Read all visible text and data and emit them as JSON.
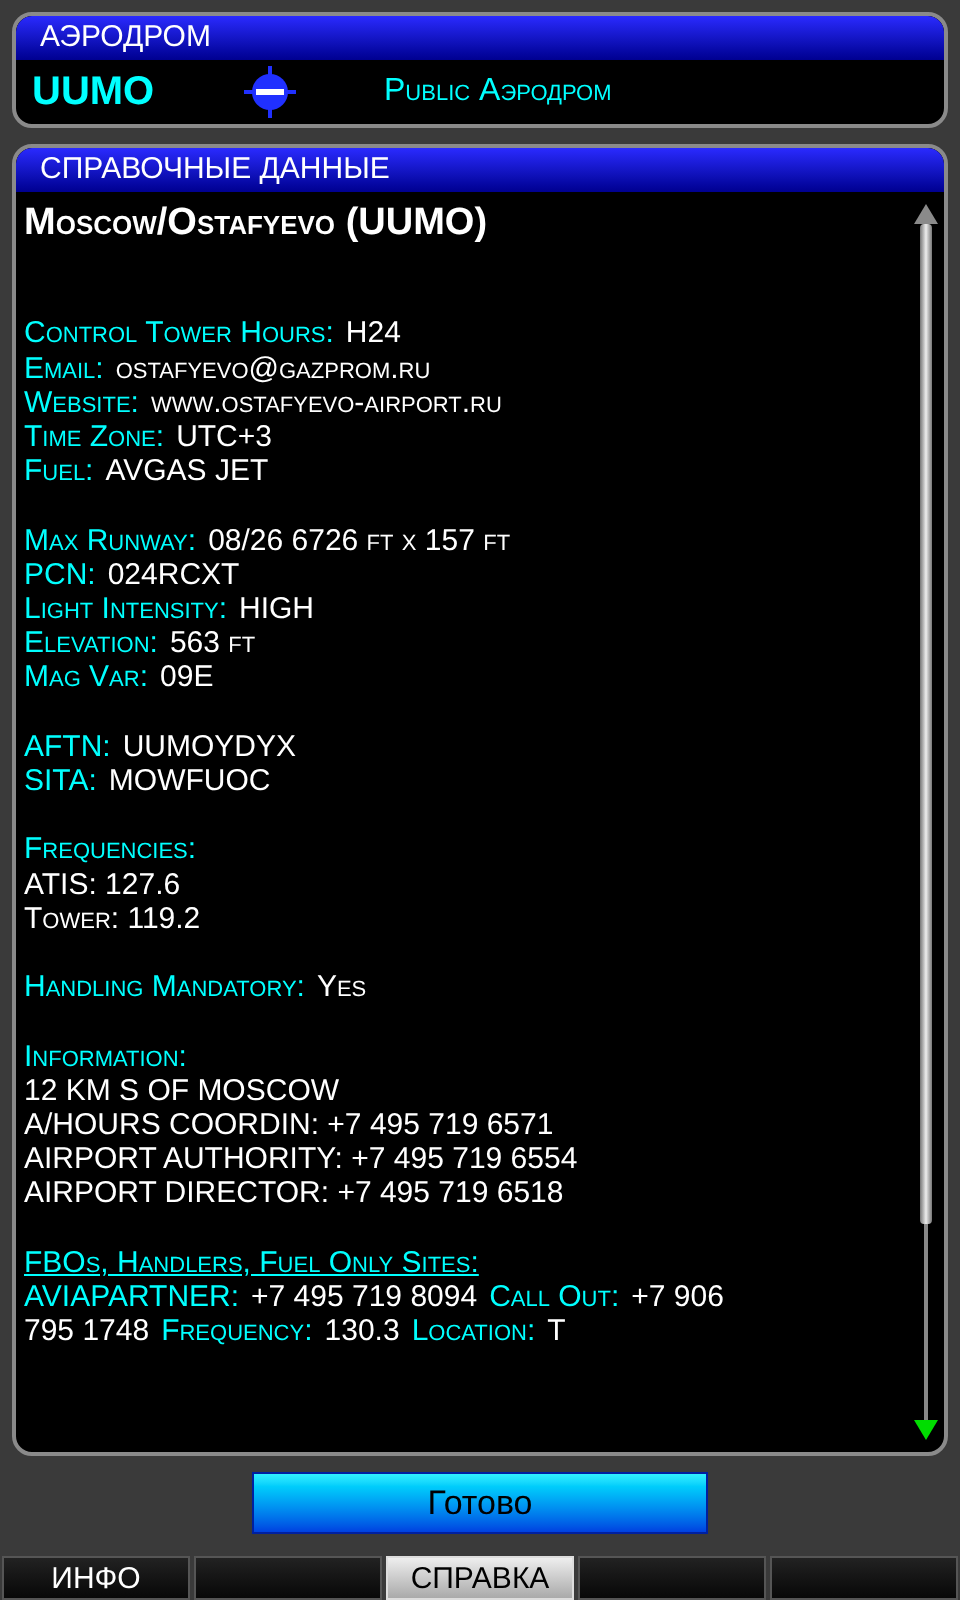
{
  "airport_panel": {
    "title": "АЭРОДРОМ",
    "ident": "UUMO",
    "type": "Public Аэродром"
  },
  "info_panel": {
    "title": "СПРАВОЧНЫЕ ДАННЫЕ",
    "heading": "Moscow/Ostafyevo (UUMO)",
    "lines": [
      {
        "kind": "blank"
      },
      {
        "kind": "blank"
      },
      {
        "kind": "text",
        "parts": [
          {
            "kind": "label",
            "text": "Control Tower Hours:"
          },
          {
            "kind": "value",
            "text": "H24"
          }
        ]
      },
      {
        "kind": "text",
        "parts": [
          {
            "kind": "label",
            "text": "Email:"
          },
          {
            "kind": "value",
            "text": "ostafyevo@gazprom.ru"
          }
        ]
      },
      {
        "kind": "text",
        "parts": [
          {
            "kind": "label",
            "text": "Website:"
          },
          {
            "kind": "value",
            "text": "www.ostafyevo-airport.ru"
          }
        ]
      },
      {
        "kind": "text",
        "parts": [
          {
            "kind": "label",
            "text": "Time Zone:"
          },
          {
            "kind": "value",
            "text": "UTC+3"
          }
        ]
      },
      {
        "kind": "text",
        "parts": [
          {
            "kind": "label",
            "text": "Fuel:"
          },
          {
            "kind": "value",
            "text": "AVGAS JET"
          }
        ]
      },
      {
        "kind": "blank"
      },
      {
        "kind": "text",
        "parts": [
          {
            "kind": "label",
            "text": "Max Runway:"
          },
          {
            "kind": "value",
            "text": "08/26 6726 ft x 157 ft"
          }
        ]
      },
      {
        "kind": "text",
        "parts": [
          {
            "kind": "label",
            "text": "PCN:"
          },
          {
            "kind": "value",
            "text": "024RCXT"
          }
        ]
      },
      {
        "kind": "text",
        "parts": [
          {
            "kind": "label",
            "text": "Light Intensity:"
          },
          {
            "kind": "value",
            "text": "HIGH"
          }
        ]
      },
      {
        "kind": "text",
        "parts": [
          {
            "kind": "label",
            "text": "Elevation:"
          },
          {
            "kind": "value",
            "text": "563 ft"
          }
        ]
      },
      {
        "kind": "text",
        "parts": [
          {
            "kind": "label",
            "text": "Mag Var:"
          },
          {
            "kind": "value",
            "text": "09E"
          }
        ]
      },
      {
        "kind": "blank"
      },
      {
        "kind": "text",
        "parts": [
          {
            "kind": "label",
            "text": "AFTN:"
          },
          {
            "kind": "value",
            "text": "UUMOYDYX"
          }
        ]
      },
      {
        "kind": "text",
        "parts": [
          {
            "kind": "label",
            "text": "SITA:"
          },
          {
            "kind": "value",
            "text": "MOWFUOC"
          }
        ]
      },
      {
        "kind": "blank"
      },
      {
        "kind": "text",
        "parts": [
          {
            "kind": "label",
            "text": "Frequencies:"
          }
        ]
      },
      {
        "kind": "text",
        "parts": [
          {
            "kind": "value",
            "text": "ATIS: 127.6"
          }
        ]
      },
      {
        "kind": "text",
        "parts": [
          {
            "kind": "value",
            "text": "Tower: 119.2"
          }
        ]
      },
      {
        "kind": "blank"
      },
      {
        "kind": "text",
        "parts": [
          {
            "kind": "label",
            "text": "Handling Mandatory:"
          },
          {
            "kind": "value",
            "text": "Yes"
          }
        ]
      },
      {
        "kind": "blank"
      },
      {
        "kind": "text",
        "parts": [
          {
            "kind": "label",
            "text": "Information:"
          }
        ]
      },
      {
        "kind": "text",
        "parts": [
          {
            "kind": "value",
            "text": "12 KM S OF MOSCOW"
          }
        ]
      },
      {
        "kind": "text",
        "parts": [
          {
            "kind": "value",
            "text": "A/HOURS COORDIN: +7 495 719 6571"
          }
        ]
      },
      {
        "kind": "text",
        "parts": [
          {
            "kind": "value",
            "text": "AIRPORT AUTHORITY: +7 495 719 6554"
          }
        ]
      },
      {
        "kind": "text",
        "parts": [
          {
            "kind": "value",
            "text": "AIRPORT DIRECTOR: +7 495 719 6518"
          }
        ]
      },
      {
        "kind": "blank"
      },
      {
        "kind": "text",
        "parts": [
          {
            "kind": "link",
            "text": "FBOs, Handlers, Fuel Only Sites:"
          }
        ]
      },
      {
        "kind": "text",
        "parts": [
          {
            "kind": "label",
            "text": "AVIAPARTNER:"
          },
          {
            "kind": "value",
            "text": "+7 495 719 8094"
          },
          {
            "kind": "label",
            "text": "Call Out:"
          },
          {
            "kind": "value",
            "text": "+7 906"
          }
        ]
      },
      {
        "kind": "text",
        "parts": [
          {
            "kind": "value",
            "text": "795 1748"
          },
          {
            "kind": "label",
            "text": "Frequency:"
          },
          {
            "kind": "value",
            "text": "130.3"
          },
          {
            "kind": "label",
            "text": "Location:"
          },
          {
            "kind": "value",
            "text": "T"
          }
        ]
      }
    ]
  },
  "done_button": "Готово",
  "softkeys": [
    {
      "label": "ИНФО",
      "selected": false
    },
    {
      "selected": false
    },
    {
      "label": "СПРАВКА",
      "selected": true
    },
    {
      "selected": false
    },
    {
      "selected": false
    }
  ]
}
